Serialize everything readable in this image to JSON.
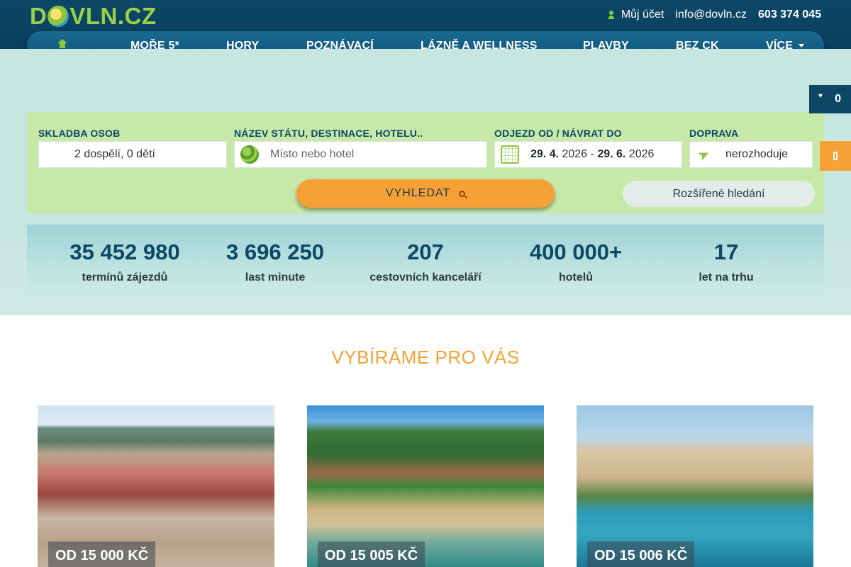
{
  "brand": {
    "logo_prefix": "D",
    "logo_rest": "VLN",
    "logo_suffix": ".CZ"
  },
  "top_links": {
    "account": "Můj účet",
    "email": "info@dovln.cz",
    "phone": "603 374 045"
  },
  "nav": {
    "items": [
      {
        "label": "MOŘE 5*"
      },
      {
        "label": "HORY"
      },
      {
        "label": "POZNÁVACÍ"
      },
      {
        "label": "LÁZNĚ A WELLNESS"
      },
      {
        "label": "PLAVBY"
      },
      {
        "label": "BEZ CK"
      },
      {
        "label": "VÍCE"
      }
    ]
  },
  "favorites": {
    "count": "0"
  },
  "search": {
    "persons": {
      "label": "SKLADBA OSOB",
      "value": "2 dospělí, 0 dětí"
    },
    "destination": {
      "label": "NÁZEV STÁTU, DESTINACE, HOTELU..",
      "placeholder": "Místo nebo hotel"
    },
    "dates": {
      "label": "ODJEZD OD / NÁVRAT DO",
      "from_day": "29. 4.",
      "from_year": "2026",
      "separator": "-",
      "to_day": "29. 6.",
      "to_year": "2026"
    },
    "transport": {
      "label": "DOPRAVA",
      "value": "nerozhoduje"
    },
    "submit_label": "VYHLEDAT",
    "advanced_label": "Rozšířené hledání"
  },
  "stats": [
    {
      "number": "35 452 980",
      "label": "termínů zájezdů"
    },
    {
      "number": "3 696 250",
      "label": "last minute"
    },
    {
      "number": "207",
      "label": "cestovních kanceláří"
    },
    {
      "number": "400 000+",
      "label": "hotelů"
    },
    {
      "number": "17",
      "label": "let na trhu"
    }
  ],
  "picks": {
    "title": "VYBÍRÁME PRO VÁS",
    "cards": [
      {
        "price": "OD 15 000 KČ"
      },
      {
        "price": "OD 15 005 KČ"
      },
      {
        "price": "OD 15 006 KČ"
      }
    ]
  },
  "colors": {
    "navy": "#0c4866",
    "green": "#8cc63f",
    "orange": "#f6a136",
    "search_bg": "#c6e8a8"
  }
}
